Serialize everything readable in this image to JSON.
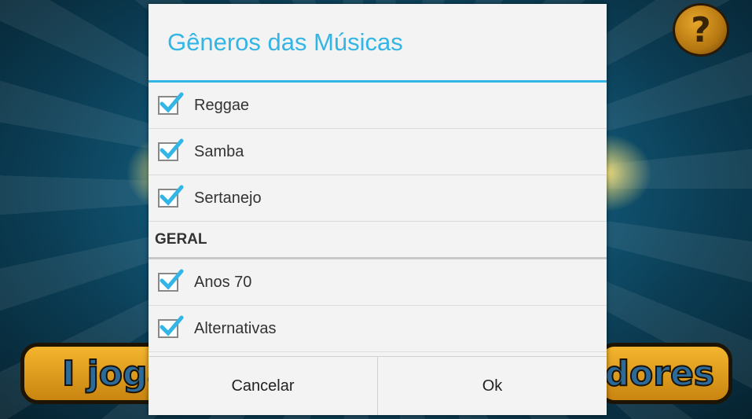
{
  "background": {
    "left_button_label": "I joga",
    "right_button_label": "adores",
    "help_label": "?"
  },
  "dialog": {
    "title": "Gêneros das Músicas",
    "items_top": [
      {
        "label": "Reggae",
        "checked": true
      },
      {
        "label": "Samba",
        "checked": true
      },
      {
        "label": "Sertanejo",
        "checked": true
      }
    ],
    "section_header": "GERAL",
    "items_bottom": [
      {
        "label": "Anos 70",
        "checked": true
      },
      {
        "label": "Alternativas",
        "checked": true
      }
    ],
    "cancel_label": "Cancelar",
    "ok_label": "Ok"
  },
  "colors": {
    "accent": "#33b5e5",
    "check": "#33b5e5"
  },
  "icons": [
    "help-icon",
    "checkbox-checked-icon"
  ]
}
